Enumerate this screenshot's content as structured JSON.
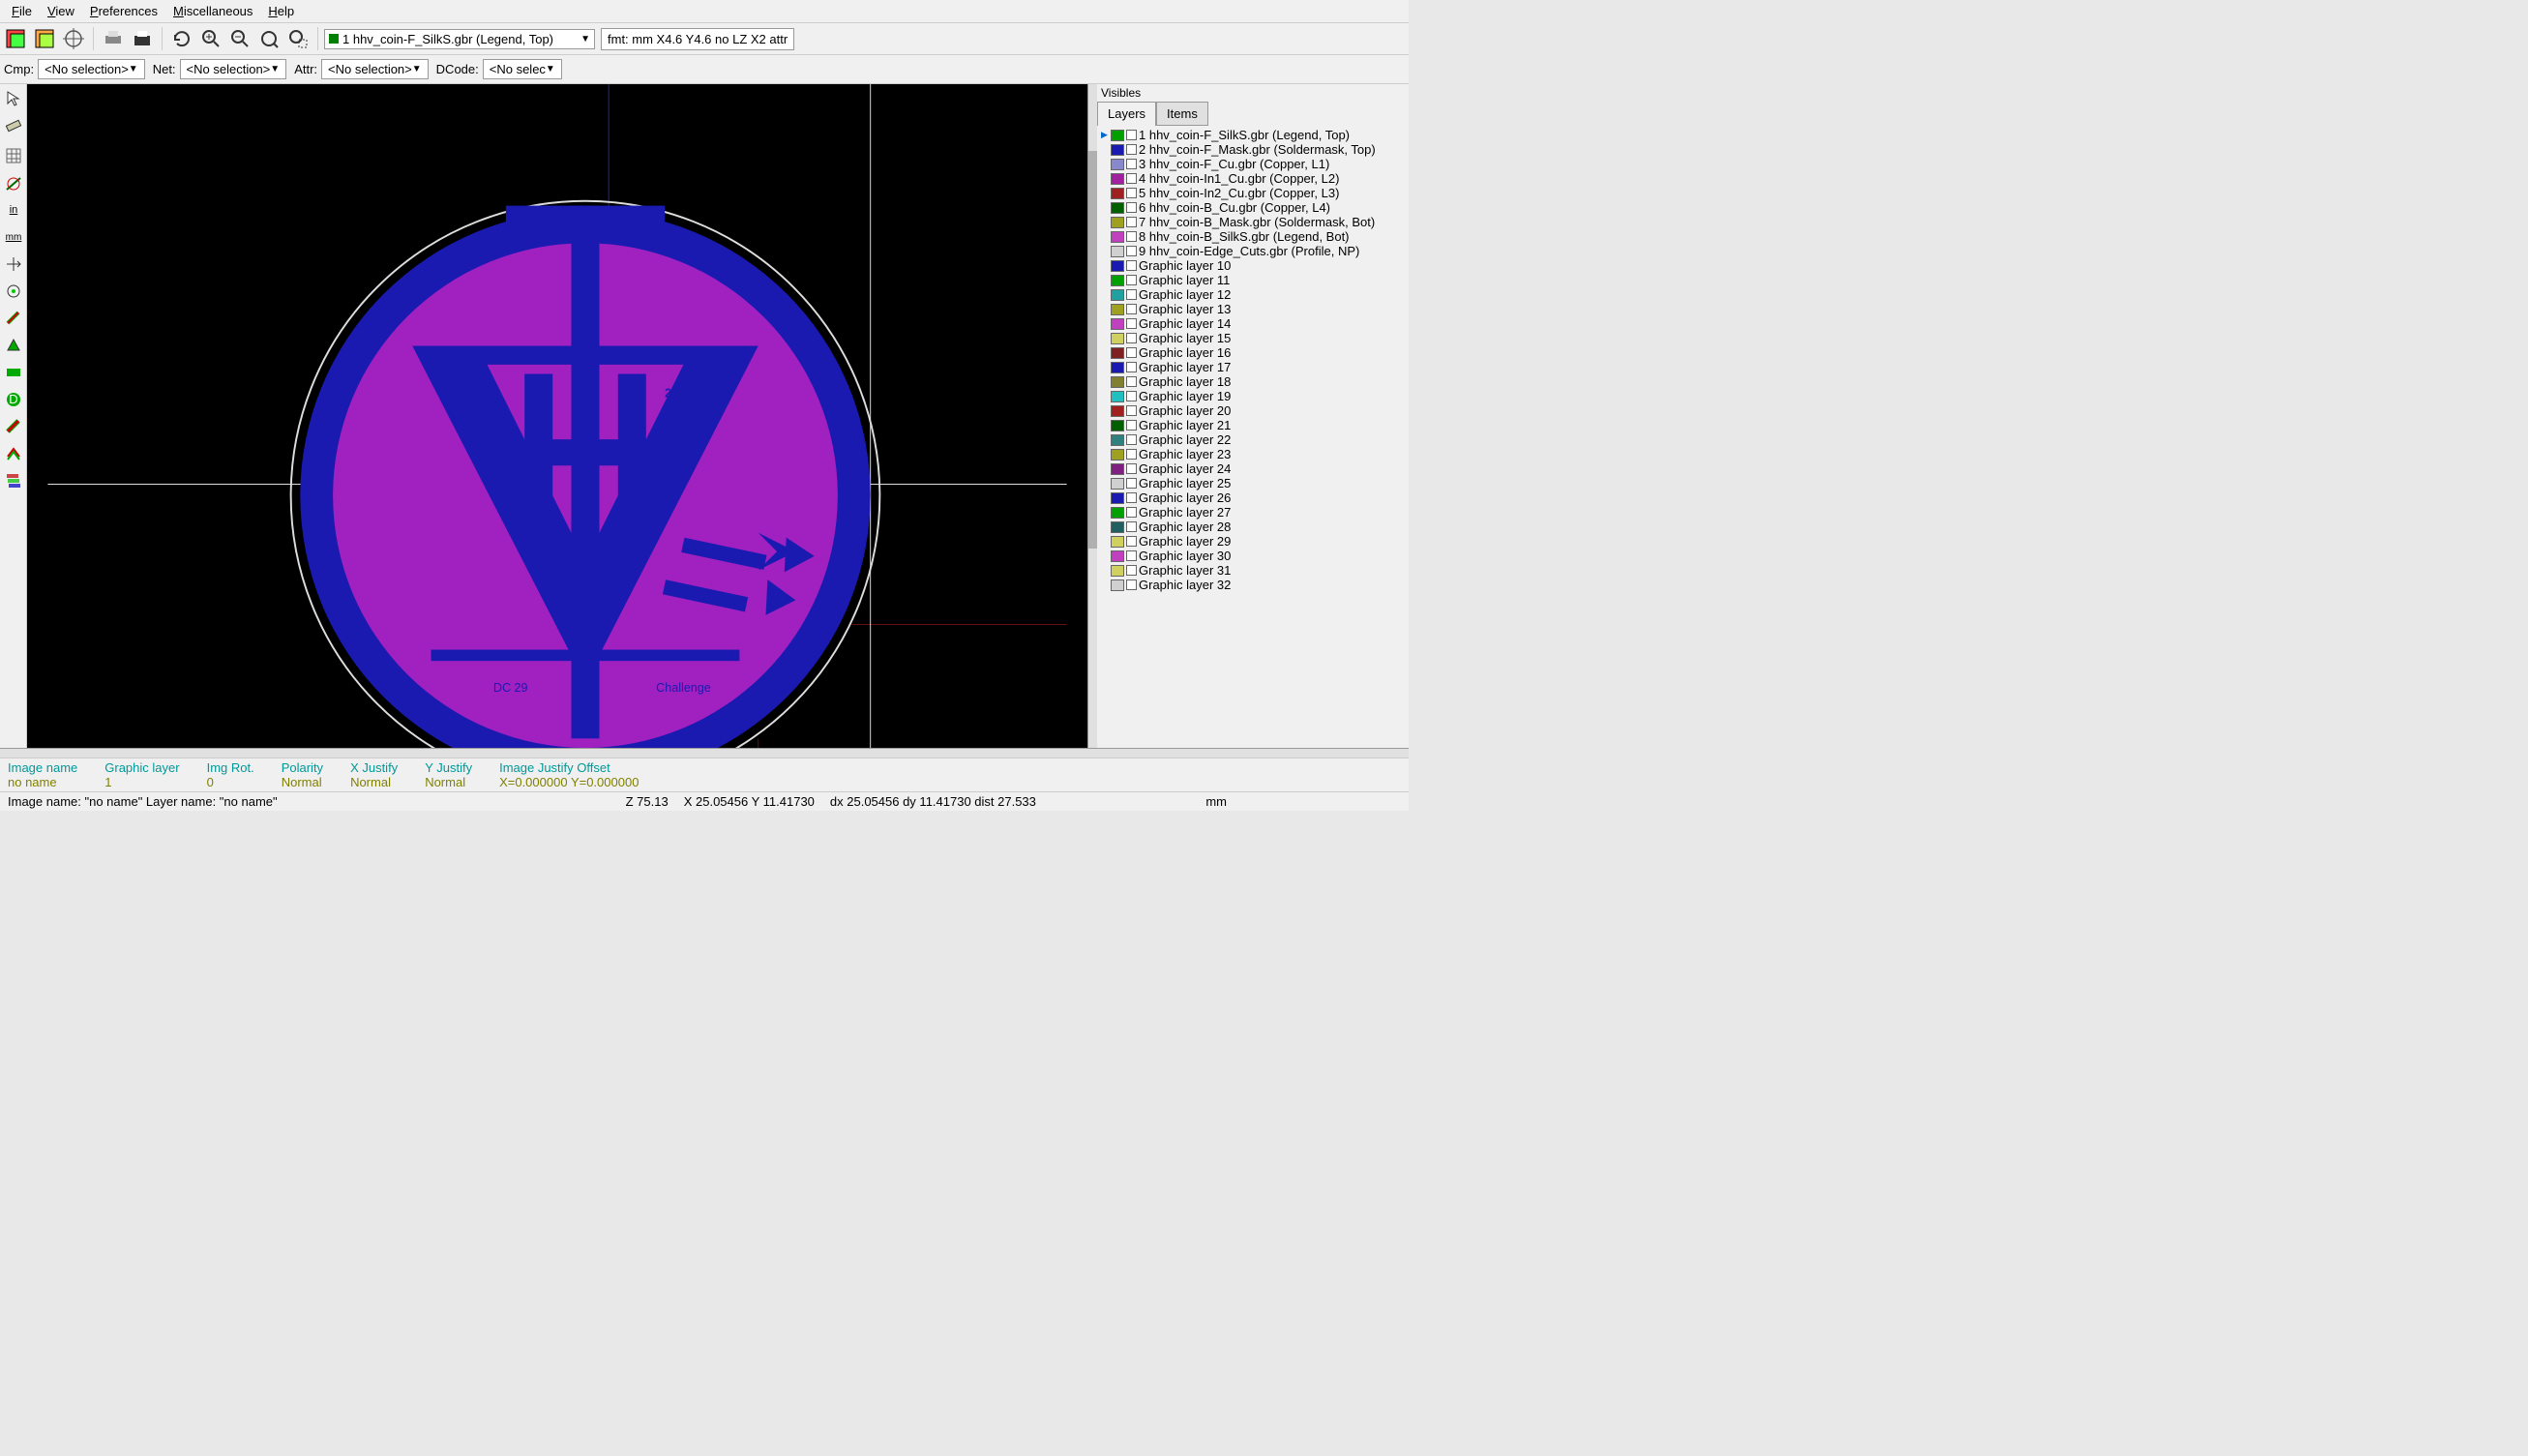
{
  "menu": [
    "File",
    "View",
    "Preferences",
    "Miscellaneous",
    "Help"
  ],
  "toolbar": {
    "layer_select": "1 hhv_coin-F_SilkS.gbr (Legend, Top)",
    "fmt": "fmt: mm X4.6 Y4.6 no LZ X2 attr"
  },
  "selectors": {
    "cmp_label": "Cmp:",
    "cmp_value": "<No selection>",
    "net_label": "Net:",
    "net_value": "<No selection>",
    "attr_label": "Attr:",
    "attr_value": "<No selection>",
    "dcode_label": "DCode:",
    "dcode_value": "<No selec"
  },
  "visibles_label": "Visibles",
  "tabs": [
    "Layers",
    "Items"
  ],
  "layers": [
    {
      "active": true,
      "color": "#00a000",
      "label": "1 hhv_coin-F_SilkS.gbr (Legend, Top)"
    },
    {
      "color": "#1a1ab0",
      "label": "2 hhv_coin-F_Mask.gbr (Soldermask, Top)"
    },
    {
      "color": "#8888cc",
      "label": "3 hhv_coin-F_Cu.gbr (Copper, L1)"
    },
    {
      "color": "#a020a0",
      "label": "4 hhv_coin-In1_Cu.gbr (Copper, L2)"
    },
    {
      "color": "#a02020",
      "label": "5 hhv_coin-In2_Cu.gbr (Copper, L3)"
    },
    {
      "color": "#006000",
      "label": "6 hhv_coin-B_Cu.gbr (Copper, L4)"
    },
    {
      "color": "#a0a020",
      "label": "7 hhv_coin-B_Mask.gbr (Soldermask, Bot)"
    },
    {
      "color": "#c040c0",
      "label": "8 hhv_coin-B_SilkS.gbr (Legend, Bot)"
    },
    {
      "color": "#d0d0d0",
      "label": "9 hhv_coin-Edge_Cuts.gbr (Profile, NP)"
    },
    {
      "color": "#1a1ab0",
      "label": "Graphic layer 10"
    },
    {
      "color": "#00a000",
      "label": "Graphic layer 11"
    },
    {
      "color": "#20a0a0",
      "label": "Graphic layer 12"
    },
    {
      "color": "#a0a020",
      "label": "Graphic layer 13"
    },
    {
      "color": "#c040c0",
      "label": "Graphic layer 14"
    },
    {
      "color": "#d0d060",
      "label": "Graphic layer 15"
    },
    {
      "color": "#802020",
      "label": "Graphic layer 16"
    },
    {
      "color": "#1a1ab0",
      "label": "Graphic layer 17"
    },
    {
      "color": "#808030",
      "label": "Graphic layer 18"
    },
    {
      "color": "#20c0c0",
      "label": "Graphic layer 19"
    },
    {
      "color": "#a02020",
      "label": "Graphic layer 20"
    },
    {
      "color": "#006000",
      "label": "Graphic layer 21"
    },
    {
      "color": "#308080",
      "label": "Graphic layer 22"
    },
    {
      "color": "#a0a020",
      "label": "Graphic layer 23"
    },
    {
      "color": "#802080",
      "label": "Graphic layer 24"
    },
    {
      "color": "#d0d0d0",
      "label": "Graphic layer 25"
    },
    {
      "color": "#1a1ab0",
      "label": "Graphic layer 26"
    },
    {
      "color": "#00a000",
      "label": "Graphic layer 27"
    },
    {
      "color": "#206060",
      "label": "Graphic layer 28"
    },
    {
      "color": "#d0d060",
      "label": "Graphic layer 29"
    },
    {
      "color": "#c040c0",
      "label": "Graphic layer 30"
    },
    {
      "color": "#d0d060",
      "label": "Graphic layer 31"
    },
    {
      "color": "#d0d0d0",
      "label": "Graphic layer 32"
    }
  ],
  "canvas": {
    "text_left": "DC 29",
    "text_right": "Challenge"
  },
  "status1": [
    {
      "hdr": "Image name",
      "val": "no name"
    },
    {
      "hdr": "Graphic layer",
      "val": "1"
    },
    {
      "hdr": "Img Rot.",
      "val": "0"
    },
    {
      "hdr": "Polarity",
      "val": "Normal"
    },
    {
      "hdr": "X Justify",
      "val": "Normal"
    },
    {
      "hdr": "Y Justify",
      "val": "Normal"
    },
    {
      "hdr": "Image Justify Offset",
      "val": "X=0.000000 Y=0.000000"
    }
  ],
  "status2": {
    "left": "Image name: \"no name\"  Layer name: \"no name\"",
    "z": "Z 75.13",
    "xy": "X 25.05456  Y 11.41730",
    "dxy": "dx 25.05456  dy 11.41730  dist 27.533",
    "unit": "mm"
  }
}
